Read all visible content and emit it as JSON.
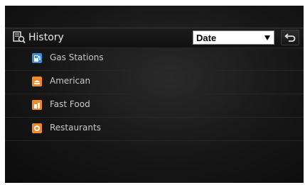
{
  "header": {
    "title": "History",
    "title_icon": "history-icon",
    "sort": {
      "selected": "Date",
      "icon": "dropdown-arrow-icon"
    },
    "back_icon": "back-arrow-icon"
  },
  "categories": [
    {
      "label": "Gas Stations",
      "icon": "gas-station-icon",
      "color": "#3b8fd9"
    },
    {
      "label": "American",
      "icon": "american-food-icon",
      "color": "#ee8a2a"
    },
    {
      "label": "Fast Food",
      "icon": "fast-food-icon",
      "color": "#ee8a2a"
    },
    {
      "label": "Restaurants",
      "icon": "restaurant-icon",
      "color": "#ee8a2a"
    }
  ]
}
